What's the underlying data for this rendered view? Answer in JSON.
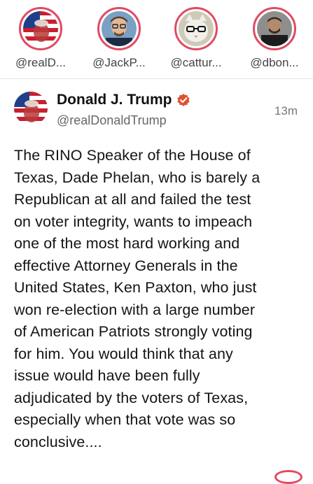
{
  "stories": [
    {
      "handle": "@realD...",
      "avatar_icon": "flag-portrait-avatar"
    },
    {
      "handle": "@JackP...",
      "avatar_icon": "man-glasses-avatar"
    },
    {
      "handle": "@cattur...",
      "avatar_icon": "cat-glasses-avatar"
    },
    {
      "handle": "@dbon...",
      "avatar_icon": "man-dark-avatar"
    }
  ],
  "post": {
    "display_name": "Donald J. Trump",
    "username": "@realDonaldTrump",
    "timestamp": "13m",
    "verified_icon": "verified-badge-icon",
    "lines": [
      "The RINO Speaker of the House of",
      "Texas, Dade Phelan, who is barely a",
      "Republican at all and failed the test",
      "on voter integrity, wants to impeach",
      "one of the most hard working and",
      "effective Attorney Generals in the",
      "United States, Ken Paxton, who just",
      "won re-election with a large number",
      "of American Patriots strongly voting",
      "for him. You would think that any",
      "issue would have been fully",
      "adjudicated by the voters of Texas,",
      "especially when that vote was so",
      "conclusive...."
    ]
  },
  "colors": {
    "ring": "#e14a63",
    "verified": "#e0522f",
    "text": "#141414",
    "muted": "#666666"
  }
}
